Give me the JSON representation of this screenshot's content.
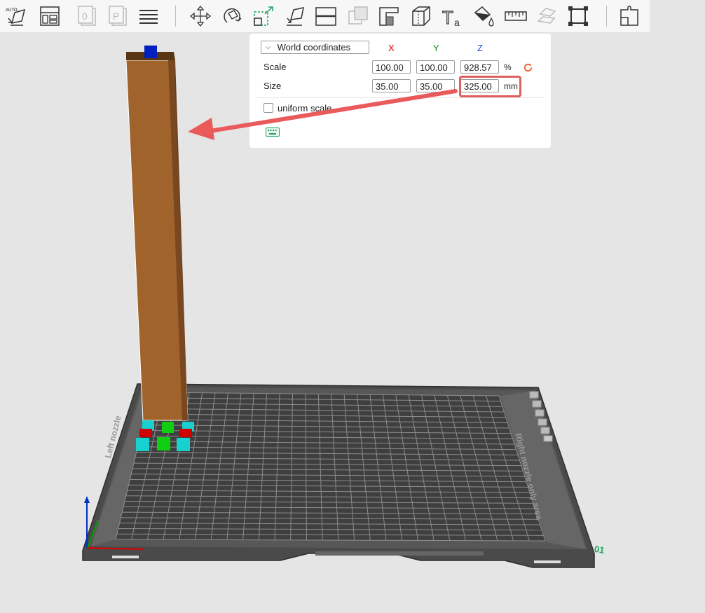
{
  "toolbar": {
    "buttons": [
      {
        "name": "auto-orient-icon",
        "badge": "AUTO"
      },
      {
        "name": "arrange-icon"
      },
      {
        "name": "add-plate-icon",
        "glyph": "0"
      },
      {
        "name": "plate-icon",
        "glyph": "P"
      },
      {
        "name": "layers-icon"
      },
      {
        "name": "move-icon"
      },
      {
        "name": "rotate-icon"
      },
      {
        "name": "scale-icon"
      },
      {
        "name": "lay-on-face-icon"
      },
      {
        "name": "cut-icon"
      },
      {
        "name": "boolean-icon"
      },
      {
        "name": "support-paint-icon"
      },
      {
        "name": "seam-icon"
      },
      {
        "name": "text-icon",
        "glyph": "Ta"
      },
      {
        "name": "color-paint-icon"
      },
      {
        "name": "measure-icon"
      },
      {
        "name": "assembly-icon"
      },
      {
        "name": "fit-view-icon"
      },
      {
        "name": "assemble-view-icon"
      }
    ]
  },
  "panel": {
    "coordinate_system": "World coordinates",
    "axis_labels": {
      "x": "X",
      "y": "Y",
      "z": "Z"
    },
    "scale": {
      "label": "Scale",
      "x": "100.00",
      "y": "100.00",
      "z": "928.57",
      "unit": "%"
    },
    "size": {
      "label": "Size",
      "x": "35.00",
      "y": "35.00",
      "z": "325.00",
      "unit": "mm"
    },
    "uniform_scale_label": "uniform scale",
    "uniform_scale_checked": false
  },
  "bed": {
    "left_label": "Left nozzle",
    "right_label": "Right nozzle only area",
    "plate_number": "01"
  },
  "colors": {
    "toolbar_bg": "#f7f7f7",
    "viewport_bg": "#e5e5e5",
    "object": "#a0632c",
    "highlight": "#e05f5f",
    "x_axis": "#e00000",
    "y_axis": "#00a000",
    "z_axis": "#0030c0",
    "accent_green": "#1aa35a"
  }
}
